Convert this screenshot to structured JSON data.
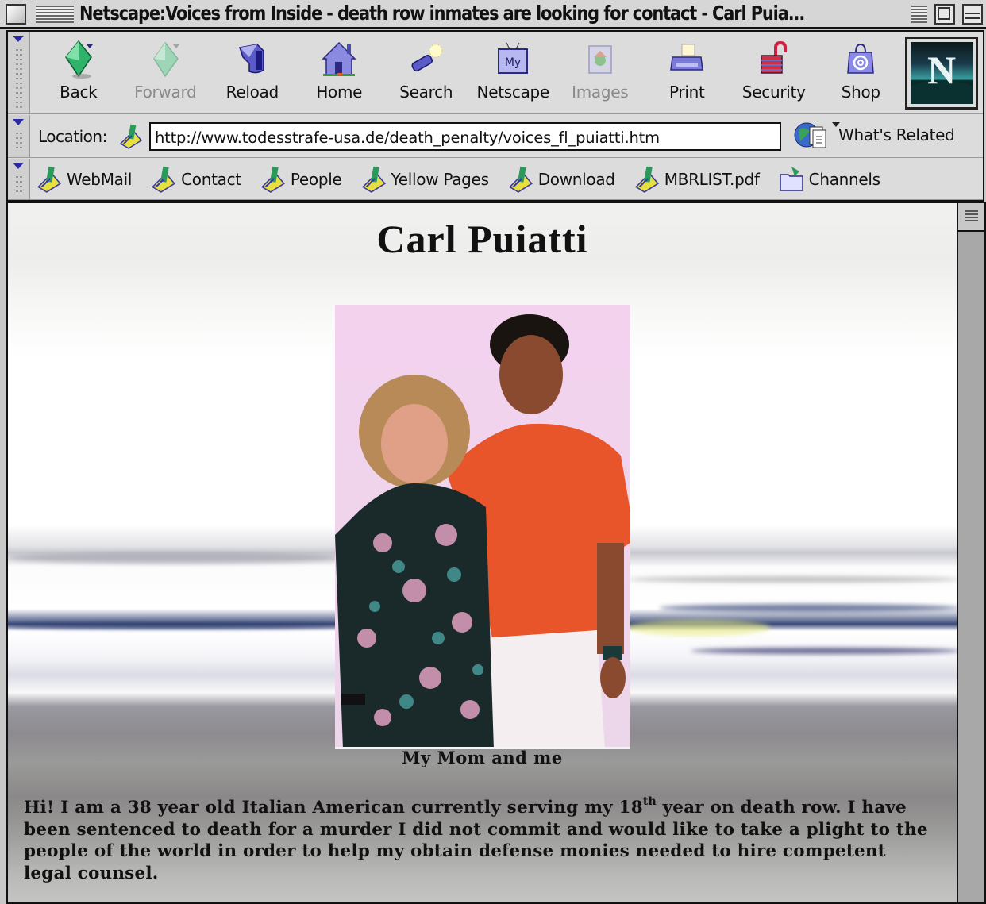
{
  "window": {
    "title": "Netscape:Voices from Inside - death row inmates are looking for contact - Carl Puia..."
  },
  "navigation_toolbar": {
    "buttons": [
      {
        "label": "Back",
        "icon": "back-arrow-icon",
        "enabled": true
      },
      {
        "label": "Forward",
        "icon": "forward-arrow-icon",
        "enabled": false
      },
      {
        "label": "Reload",
        "icon": "reload-icon",
        "enabled": true
      },
      {
        "label": "Home",
        "icon": "home-icon",
        "enabled": true
      },
      {
        "label": "Search",
        "icon": "search-flashlight-icon",
        "enabled": true
      },
      {
        "label": "Netscape",
        "icon": "my-netscape-icon",
        "enabled": true
      },
      {
        "label": "Images",
        "icon": "images-icon",
        "enabled": false
      },
      {
        "label": "Print",
        "icon": "printer-icon",
        "enabled": true
      },
      {
        "label": "Security",
        "icon": "padlock-icon",
        "enabled": true
      },
      {
        "label": "Shop",
        "icon": "shopping-bag-icon",
        "enabled": true
      }
    ],
    "logo_letter": "N"
  },
  "location_toolbar": {
    "label": "Location:",
    "url": "http://www.todesstrafe-usa.de/death_penalty/voices_fl_puiatti.htm",
    "related_label": "What's Related"
  },
  "personal_toolbar": {
    "items": [
      {
        "label": "WebMail",
        "icon": "bookmark-icon"
      },
      {
        "label": "Contact",
        "icon": "bookmark-icon"
      },
      {
        "label": "People",
        "icon": "bookmark-icon"
      },
      {
        "label": "Yellow Pages",
        "icon": "bookmark-icon"
      },
      {
        "label": "Download",
        "icon": "bookmark-icon"
      },
      {
        "label": "MBRLIST.pdf",
        "icon": "bookmark-icon"
      },
      {
        "label": "Channels",
        "icon": "channels-folder-icon"
      }
    ]
  },
  "page": {
    "heading": "Carl Puiatti",
    "photo_alt": "Photo of a woman in a floral blouse and a man in an orange shirt",
    "caption": "My Mom and me",
    "intro_part1": "Hi! I am a 38 year old Italian American currently serving my 18",
    "intro_sup": "th",
    "intro_part2": " year on death row. I have been sentenced to death for a murder I did not commit and would like to take a plight to the people of the world in order to help my obtain defense monies needed to hire competent legal counsel."
  },
  "colors": {
    "chrome_bg": "#dcdcdc",
    "toolbar_triangle": "#2a2aa8",
    "text": "#111111",
    "disabled_text": "#8a8a8a",
    "scrollbar_track": "#a8a8a8"
  }
}
